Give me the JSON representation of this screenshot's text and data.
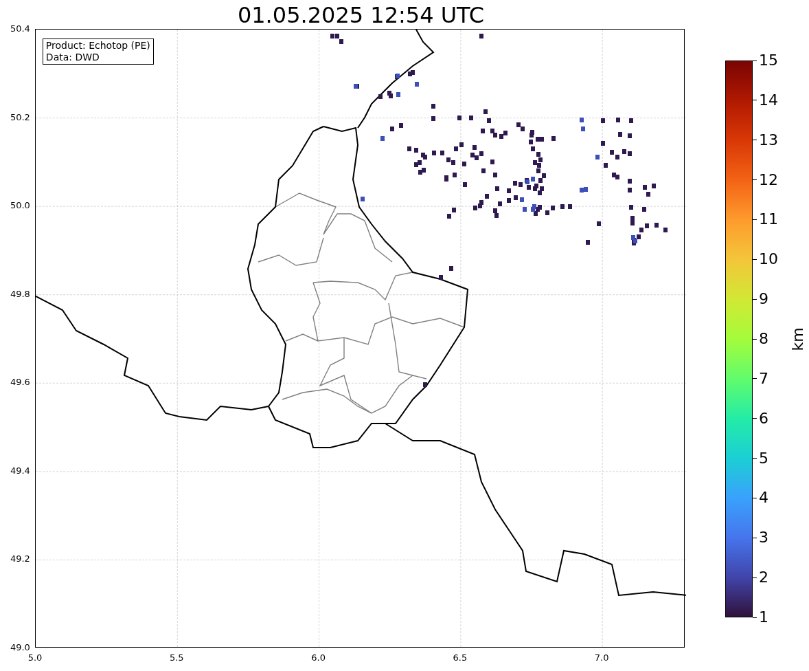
{
  "title": "01.05.2025 12:54 UTC",
  "info_box": {
    "lines": [
      "Product: Echotop (PE)",
      "Data: DWD"
    ]
  },
  "x_axis": {
    "ticks": [
      "5.0",
      "5.5",
      "6.0",
      "6.5",
      "7.0"
    ]
  },
  "y_axis": {
    "ticks": [
      "50.4",
      "50.2",
      "50.0",
      "49.8",
      "49.6",
      "49.4",
      "49.2",
      "49.0"
    ]
  },
  "colorbar": {
    "label": "km",
    "ticks": [
      "15",
      "14",
      "13",
      "12",
      "11",
      "10",
      "9",
      "8",
      "7",
      "6",
      "5",
      "4",
      "3",
      "2",
      "1"
    ]
  }
}
